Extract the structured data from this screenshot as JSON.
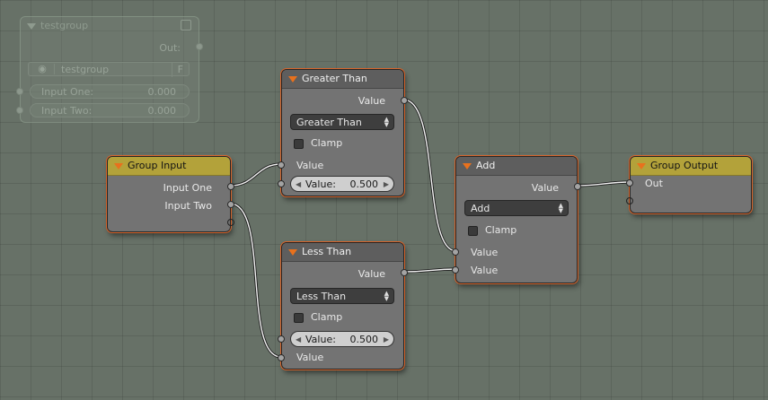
{
  "frame_node": {
    "title": "testgroup",
    "output_label": "Out:",
    "datablock_name": "testgroup",
    "fake_user_label": "F",
    "inputs": [
      {
        "label": "Input One:",
        "value": "0.000"
      },
      {
        "label": "Input Two:",
        "value": "0.000"
      }
    ]
  },
  "group_input": {
    "title": "Group Input",
    "outputs": [
      "Input One",
      "Input Two"
    ]
  },
  "greater_than": {
    "title": "Greater Than",
    "output_label": "Value",
    "operation": "Greater Than",
    "clamp_label": "Clamp",
    "input_label": "Value",
    "field_label": "Value:",
    "field_value": "0.500"
  },
  "less_than": {
    "title": "Less Than",
    "output_label": "Value",
    "operation": "Less Than",
    "clamp_label": "Clamp",
    "field_label": "Value:",
    "field_value": "0.500",
    "input_label": "Value"
  },
  "add": {
    "title": "Add",
    "output_label": "Value",
    "operation": "Add",
    "clamp_label": "Clamp",
    "inputs": [
      "Value",
      "Value"
    ]
  },
  "group_output": {
    "title": "Group Output",
    "input_label": "Out"
  },
  "colors": {
    "background": "#677167",
    "node_body": "#737373",
    "selected_outline": "#d5632b",
    "group_header": "#b3a23a",
    "math_header": "#5e5e5e"
  }
}
